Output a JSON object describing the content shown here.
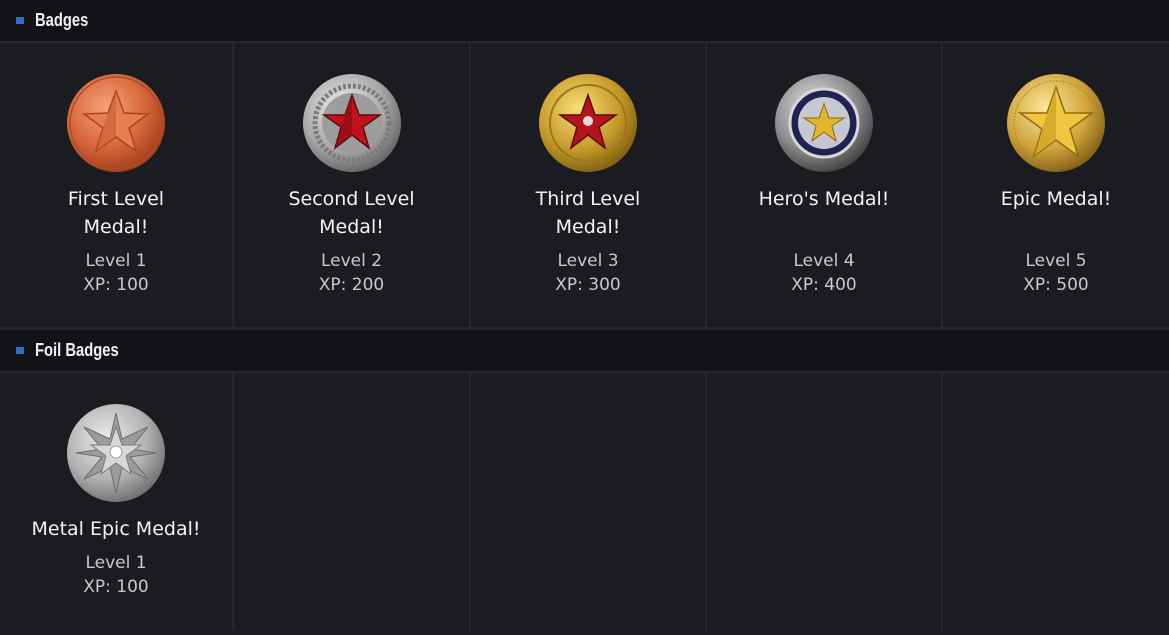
{
  "sections": [
    {
      "title": "Badges",
      "badges": [
        {
          "name": "First Level Medal!",
          "level": "Level 1",
          "xp": "XP: 100",
          "icon": "bronze-star-medal-icon"
        },
        {
          "name": "Second Level Medal!",
          "level": "Level 2",
          "xp": "XP: 200",
          "icon": "silver-red-star-medal-icon"
        },
        {
          "name": "Third Level Medal!",
          "level": "Level 3",
          "xp": "XP: 300",
          "icon": "gold-red-star-medal-icon"
        },
        {
          "name": "Hero's Medal!",
          "level": "Level 4",
          "xp": "XP: 400",
          "icon": "hero-silver-blue-medal-icon"
        },
        {
          "name": "Epic Medal!",
          "level": "Level 5",
          "xp": "XP: 500",
          "icon": "gold-star-medal-icon"
        }
      ]
    },
    {
      "title": "Foil Badges",
      "badges": [
        {
          "name": "Metal Epic Medal!",
          "level": "Level 1",
          "xp": "XP: 100",
          "icon": "metal-star-medal-icon"
        }
      ]
    }
  ],
  "colors": {
    "background": "#1b1c21",
    "header_bg": "#121317",
    "accent": "#2f6ec7",
    "text": "#f3f3f3",
    "muted_text": "#c9c9cc"
  }
}
